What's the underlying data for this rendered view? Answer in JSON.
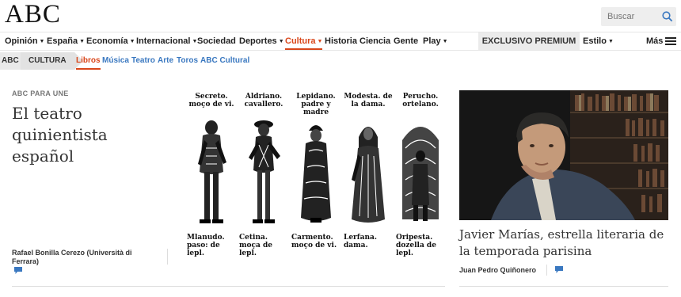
{
  "header": {
    "logo": "ABC",
    "search_placeholder": "Buscar"
  },
  "nav": {
    "items": [
      {
        "label": "Opinión",
        "has_menu": true
      },
      {
        "label": "España",
        "has_menu": true
      },
      {
        "label": "Economía",
        "has_menu": true
      },
      {
        "label": "Internacional",
        "has_menu": true
      },
      {
        "label": "Sociedad",
        "has_menu": false
      },
      {
        "label": "Deportes",
        "has_menu": true
      },
      {
        "label": "Cultura",
        "has_menu": true,
        "active": true
      },
      {
        "label": "Historia",
        "has_menu": false
      },
      {
        "label": "Ciencia",
        "has_menu": false
      },
      {
        "label": "Gente",
        "has_menu": false
      },
      {
        "label": "Play",
        "has_menu": true
      }
    ],
    "premium": "EXCLUSIVO PREMIUM",
    "style": "Estilo",
    "more": "Más"
  },
  "breadcrumb": {
    "root": "ABC",
    "section": "CULTURA"
  },
  "subnav": {
    "links": [
      {
        "label": "Libros",
        "active": true
      },
      {
        "label": "Música"
      },
      {
        "label": "Teatro"
      },
      {
        "label": "Arte"
      },
      {
        "label": "Toros"
      },
      {
        "label": "ABC Cultural"
      }
    ]
  },
  "feature": {
    "kicker": "ABC PARA UNE",
    "headline": "El teatro quinientista español",
    "author": "Rafael Bonilla Cerezo (Università di Ferrara)",
    "figures": [
      {
        "top": "Secreto. moço de vi.",
        "bottom": "Mlanudo. paso: de lepl."
      },
      {
        "top": "Aldriano. cavallero.",
        "bottom": "Cetina. moça de lepl."
      },
      {
        "top": "Lepidano. padre y madre",
        "bottom": "Carmento. moço de vi."
      },
      {
        "top": "Modesta. de la dama.",
        "bottom": "Lerfana. dama."
      },
      {
        "top": "Perucho. ortelano.",
        "bottom": "Oripesta. dozella de lepl."
      }
    ]
  },
  "secondary": {
    "headline": "Javier Marías, estrella literaria de la temporada parisina",
    "author": "Juan Pedro Quiñonero"
  },
  "colors": {
    "accent": "#d9461a",
    "link": "#3a78c0",
    "comment_icon": "#3a78c0"
  }
}
